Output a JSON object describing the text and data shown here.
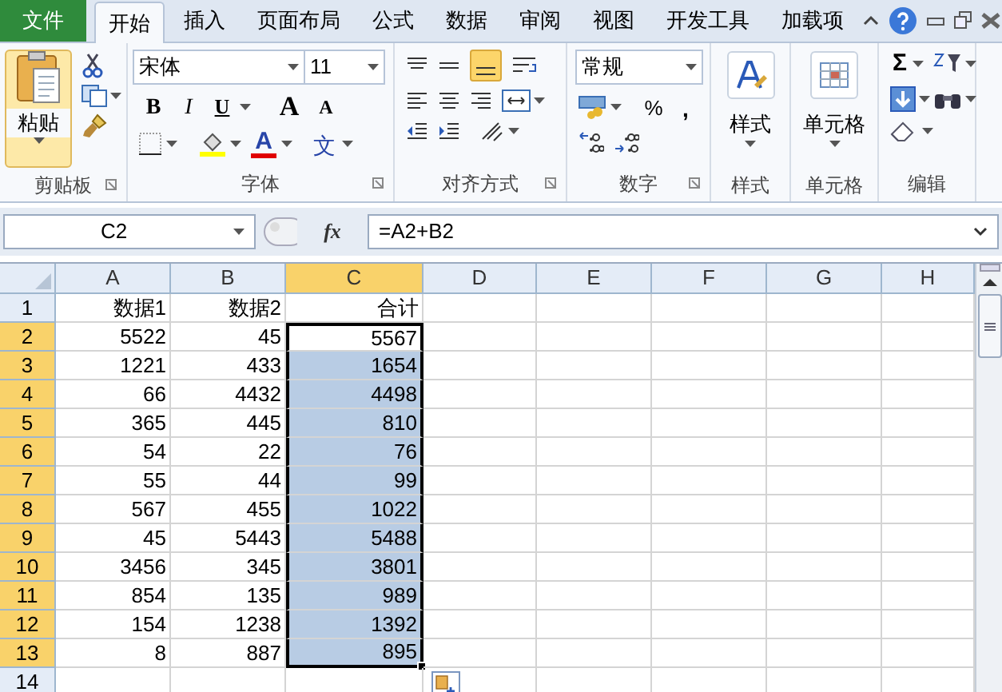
{
  "menu_tabs": [
    {
      "label": "文件",
      "kind": "file",
      "selected": false
    },
    {
      "label": "开始",
      "kind": "tab",
      "selected": true
    },
    {
      "label": "插入",
      "kind": "tab",
      "selected": false
    },
    {
      "label": "页面布局",
      "kind": "tab",
      "selected": false
    },
    {
      "label": "公式",
      "kind": "tab",
      "selected": false
    },
    {
      "label": "数据",
      "kind": "tab",
      "selected": false
    },
    {
      "label": "审阅",
      "kind": "tab",
      "selected": false
    },
    {
      "label": "视图",
      "kind": "tab",
      "selected": false
    },
    {
      "label": "开发工具",
      "kind": "tab",
      "selected": false
    },
    {
      "label": "加载项",
      "kind": "tab",
      "selected": false
    }
  ],
  "ribbon": {
    "clipboard": {
      "paste": "粘贴",
      "label": "剪贴板"
    },
    "font": {
      "name": "宋体",
      "size": "11",
      "bold": "B",
      "italic": "I",
      "underline": "U",
      "grow": "A",
      "shrink": "A",
      "font_color_letter": "A",
      "phonetic": "文",
      "label": "字体"
    },
    "alignment": {
      "label": "对齐方式"
    },
    "number": {
      "format": "常规",
      "percent": "%",
      "comma": ",",
      "label": "数字"
    },
    "styles": {
      "button": "样式",
      "label": "样式"
    },
    "cells": {
      "button": "单元格",
      "label": "单元格"
    },
    "editing": {
      "sum": "Σ",
      "label": "编辑"
    }
  },
  "formula_bar": {
    "name_box": "C2",
    "fx": "fx",
    "formula": "=A2+B2"
  },
  "sheet": {
    "columns": [
      {
        "label": "A",
        "selected": false
      },
      {
        "label": "B",
        "selected": false
      },
      {
        "label": "C",
        "selected": true
      },
      {
        "label": "D",
        "selected": false
      },
      {
        "label": "E",
        "selected": false
      },
      {
        "label": "F",
        "selected": false
      },
      {
        "label": "G",
        "selected": false
      },
      {
        "label": "H",
        "selected": false
      }
    ],
    "rows": [
      {
        "header": "1",
        "selected": false,
        "active": false,
        "cells": [
          "数据1",
          "数据2",
          "合计"
        ]
      },
      {
        "header": "2",
        "selected": true,
        "active": true,
        "cells": [
          "5522",
          "45",
          "5567"
        ]
      },
      {
        "header": "3",
        "selected": true,
        "active": false,
        "cells": [
          "1221",
          "433",
          "1654"
        ]
      },
      {
        "header": "4",
        "selected": true,
        "active": false,
        "cells": [
          "66",
          "4432",
          "4498"
        ]
      },
      {
        "header": "5",
        "selected": true,
        "active": false,
        "cells": [
          "365",
          "445",
          "810"
        ]
      },
      {
        "header": "6",
        "selected": true,
        "active": false,
        "cells": [
          "54",
          "22",
          "76"
        ]
      },
      {
        "header": "7",
        "selected": true,
        "active": false,
        "cells": [
          "55",
          "44",
          "99"
        ]
      },
      {
        "header": "8",
        "selected": true,
        "active": false,
        "cells": [
          "567",
          "455",
          "1022"
        ]
      },
      {
        "header": "9",
        "selected": true,
        "active": false,
        "cells": [
          "45",
          "5443",
          "5488"
        ]
      },
      {
        "header": "10",
        "selected": true,
        "active": false,
        "cells": [
          "3456",
          "345",
          "3801"
        ]
      },
      {
        "header": "11",
        "selected": true,
        "active": false,
        "cells": [
          "854",
          "135",
          "989"
        ]
      },
      {
        "header": "12",
        "selected": true,
        "active": false,
        "cells": [
          "154",
          "1238",
          "1392"
        ]
      },
      {
        "header": "13",
        "selected": true,
        "active": false,
        "cells": [
          "8",
          "887",
          "895"
        ]
      },
      {
        "header": "14",
        "selected": false,
        "active": false,
        "cells": []
      }
    ]
  }
}
